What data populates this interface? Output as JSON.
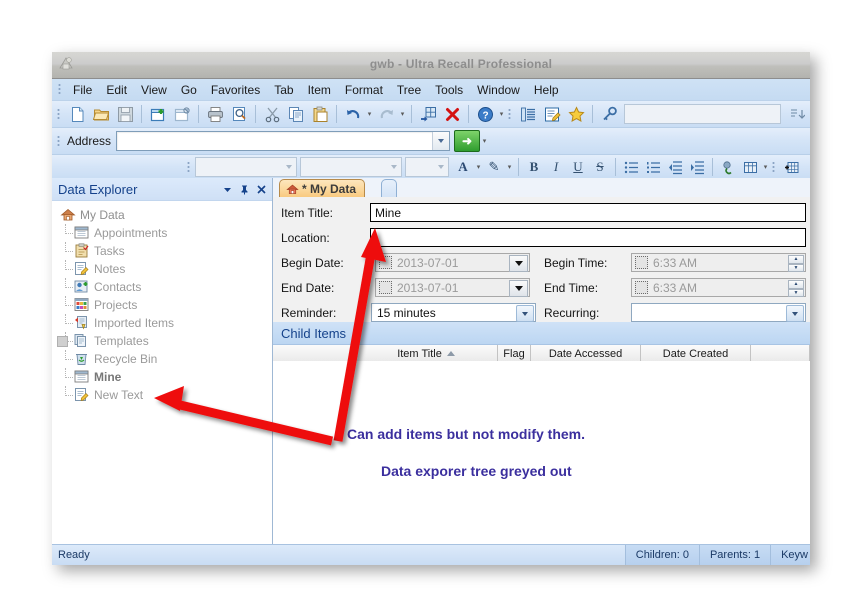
{
  "window": {
    "title": "gwb - Ultra Recall Professional",
    "app_icon": "app-icon"
  },
  "menu": {
    "items": [
      "File",
      "Edit",
      "View",
      "Go",
      "Favorites",
      "Tab",
      "Item",
      "Format",
      "Tree",
      "Tools",
      "Window",
      "Help"
    ]
  },
  "toolbar_main": {
    "buttons": [
      {
        "name": "new-document-icon",
        "glyph": "⬜"
      },
      {
        "name": "open-folder-icon",
        "glyph": "📂"
      },
      {
        "name": "save-icon",
        "glyph": "💾"
      },
      {
        "name": "new-item-icon",
        "glyph": "⬜"
      },
      {
        "name": "new-child-item-icon",
        "glyph": "⬜"
      },
      {
        "name": "print-icon",
        "glyph": "🖨"
      },
      {
        "name": "print-preview-icon",
        "glyph": "🔍"
      },
      {
        "name": "cut-icon",
        "glyph": "✂"
      },
      {
        "name": "copy-icon",
        "glyph": "⧉"
      },
      {
        "name": "paste-icon",
        "glyph": "📋"
      },
      {
        "name": "undo-icon",
        "glyph": "↶"
      },
      {
        "name": "redo-icon",
        "glyph": "↷"
      },
      {
        "name": "arrange-icon",
        "glyph": "⊞"
      },
      {
        "name": "delete-icon",
        "glyph": "✕"
      },
      {
        "name": "help-icon",
        "glyph": "?"
      },
      {
        "name": "outline-icon",
        "glyph": "☰"
      },
      {
        "name": "edit-note-icon",
        "glyph": "✎"
      },
      {
        "name": "favorite-star-icon",
        "glyph": "★"
      },
      {
        "name": "search-key-icon",
        "glyph": "🔑"
      },
      {
        "name": "find-prev-icon",
        "glyph": "←"
      },
      {
        "name": "find-next-icon",
        "glyph": "→"
      },
      {
        "name": "back-icon",
        "glyph": "◀"
      }
    ],
    "search_value": "",
    "search_placeholder": ""
  },
  "address_bar": {
    "label": "Address",
    "value": "",
    "placeholder": "",
    "go_label": "➜"
  },
  "format_toolbar": {
    "font_family_value": "",
    "font_size_value": "",
    "font_style_value": "",
    "buttons": [
      {
        "name": "font-color-icon",
        "label": "A"
      },
      {
        "name": "highlight-color-icon",
        "label": "✎"
      },
      {
        "name": "bold-icon",
        "label": "B"
      },
      {
        "name": "italic-icon",
        "label": "I"
      },
      {
        "name": "underline-icon",
        "label": "U"
      },
      {
        "name": "strikethrough-icon",
        "label": "S"
      },
      {
        "name": "bullet-list-icon",
        "label": "☰"
      },
      {
        "name": "numbered-list-icon",
        "label": "☰"
      },
      {
        "name": "decrease-indent-icon",
        "label": "⇤"
      },
      {
        "name": "increase-indent-icon",
        "label": "⇥"
      },
      {
        "name": "insert-link-icon",
        "label": "🔗"
      },
      {
        "name": "insert-table-icon",
        "label": "▦"
      }
    ]
  },
  "explorer": {
    "title": "Data Explorer",
    "header_buttons": [
      {
        "name": "panel-menu-icon",
        "glyph": "▼"
      },
      {
        "name": "pin-icon",
        "glyph": "⚓"
      },
      {
        "name": "close-panel-icon",
        "glyph": "✕"
      }
    ],
    "tree": [
      {
        "label": "My Data",
        "icon": "home-icon",
        "level": 0,
        "bold": false,
        "expander": false
      },
      {
        "label": "Appointments",
        "icon": "calendar-icon",
        "level": 1,
        "bold": false,
        "expander": false
      },
      {
        "label": "Tasks",
        "icon": "clipboard-icon",
        "level": 1,
        "bold": false,
        "expander": false
      },
      {
        "label": "Notes",
        "icon": "note-icon",
        "level": 1,
        "bold": false,
        "expander": false
      },
      {
        "label": "Contacts",
        "icon": "contact-icon",
        "level": 1,
        "bold": false,
        "expander": false
      },
      {
        "label": "Projects",
        "icon": "projects-icon",
        "level": 1,
        "bold": false,
        "expander": false
      },
      {
        "label": "Imported Items",
        "icon": "imported-icon",
        "level": 1,
        "bold": false,
        "expander": false
      },
      {
        "label": "Templates",
        "icon": "templates-icon",
        "level": 1,
        "bold": false,
        "expander": true
      },
      {
        "label": "Recycle Bin",
        "icon": "recycle-bin-icon",
        "level": 1,
        "bold": false,
        "expander": false
      },
      {
        "label": "Mine",
        "icon": "calendar-icon",
        "level": 1,
        "bold": true,
        "expander": false
      },
      {
        "label": "New Text",
        "icon": "note-icon",
        "level": 1,
        "bold": false,
        "expander": false
      }
    ]
  },
  "tabs": [
    {
      "label": "* My Data",
      "icon": "home-icon",
      "active": true
    },
    {
      "label": "",
      "icon": "",
      "active": false
    }
  ],
  "form": {
    "item_title": {
      "label": "Item Title:",
      "value": "Mine"
    },
    "location": {
      "label": "Location:",
      "value": ""
    },
    "begin_date": {
      "label": "Begin Date:",
      "value": "2013-07-01",
      "checked": false
    },
    "end_date": {
      "label": "End Date:",
      "value": "2013-07-01",
      "checked": false
    },
    "reminder": {
      "label": "Reminder:",
      "value": "15 minutes"
    },
    "begin_time": {
      "label": "Begin Time:",
      "value": "6:33 AM",
      "checked": false
    },
    "end_time": {
      "label": "End Time:",
      "value": "6:33 AM",
      "checked": false
    },
    "recurring": {
      "label": "Recurring:",
      "value": ""
    }
  },
  "child_items": {
    "title": "Child Items",
    "columns": [
      "Item Title",
      "Flag",
      "Date Accessed",
      "Date Created",
      ""
    ],
    "sort_column": "Item Title",
    "sort_direction": "ascending",
    "rows": []
  },
  "status_bar": {
    "message": "Ready",
    "children": "Children: 0",
    "parents": "Parents: 1",
    "keywords": "Keyw"
  },
  "annotations": {
    "line1": "Can add items but not modify them.",
    "line2": "Data exporer tree greyed out",
    "color": "#3b2f9e",
    "arrow_color": "#ee1111"
  }
}
